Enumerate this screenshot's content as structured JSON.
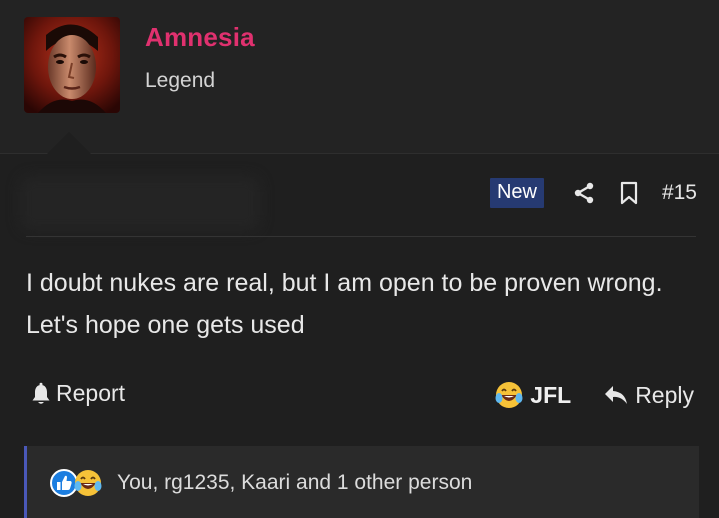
{
  "user": {
    "name": "Amnesia",
    "title": "Legend",
    "avatar_icon": "user-avatar-photo",
    "name_color": "#e0316f"
  },
  "post": {
    "badge": "New",
    "number": "#15",
    "text": "I doubt nukes are real, but I am open to be proven wrong. Let's hope one gets used",
    "share_icon": "share-icon",
    "bookmark_icon": "bookmark-icon"
  },
  "actions": {
    "report_label": "Report",
    "reaction_label": "JFL",
    "reply_label": "Reply"
  },
  "reactions": {
    "summary": "You, rg1235, Kaari and 1 other person",
    "icons": [
      "like-icon",
      "crying-laughing-emoji-icon"
    ]
  },
  "colors": {
    "background": "#232323",
    "message_bg": "#1f1f1f",
    "badge_bg": "#263a72",
    "reactions_border": "#4a58b8"
  }
}
